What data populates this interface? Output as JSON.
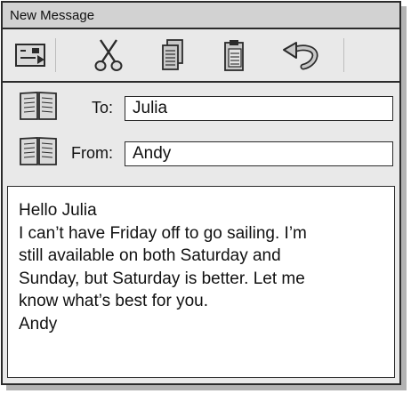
{
  "window": {
    "title": "New Message"
  },
  "toolbar": {
    "items": [
      {
        "icon": "send-icon"
      },
      {
        "icon": "scissors-icon"
      },
      {
        "icon": "copy-icon"
      },
      {
        "icon": "paste-icon"
      },
      {
        "icon": "undo-icon"
      }
    ]
  },
  "header": {
    "to_label": "To:",
    "to_value": "Julia",
    "to_icon": "address-book-icon",
    "from_label": "From:",
    "from_value": "Andy",
    "from_icon": "address-book-icon"
  },
  "message": {
    "lines": [
      "Hello Julia",
      "I can’t have Friday off to go sailing. I’m",
      "still available on both Saturday and",
      "Sunday, but Saturday is better. Let me",
      "know what’s best for you.",
      "Andy"
    ]
  },
  "colors": {
    "window_background": "#e9e9e9",
    "titlebar_background": "#d2d2d2",
    "border": "#2b2b2b",
    "shadow": "#b3b3b3",
    "icon_fill": "#c8c8c8"
  }
}
